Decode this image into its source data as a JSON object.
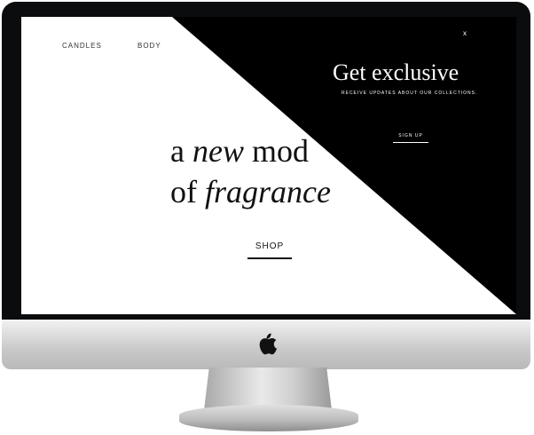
{
  "nav": {
    "items": [
      "CANDLES",
      "BODY"
    ]
  },
  "hero": {
    "line1_plain": "a",
    "line1_italic": "new",
    "line1_rest": "mod",
    "line2_plain": "of",
    "line2_italic": "fragrance",
    "shop_label": "SHOP"
  },
  "popup": {
    "title": "Get exclusive",
    "subtitle": "RECEIVE UPDATES ABOUT OUR COLLECTIONS.",
    "signup_label": "SIGN UP",
    "close_label": "x"
  },
  "device": {
    "logo_icon": "apple-logo-icon",
    "bezel_color": "#0b0c0d",
    "chin_color": "#c9c9c9"
  }
}
